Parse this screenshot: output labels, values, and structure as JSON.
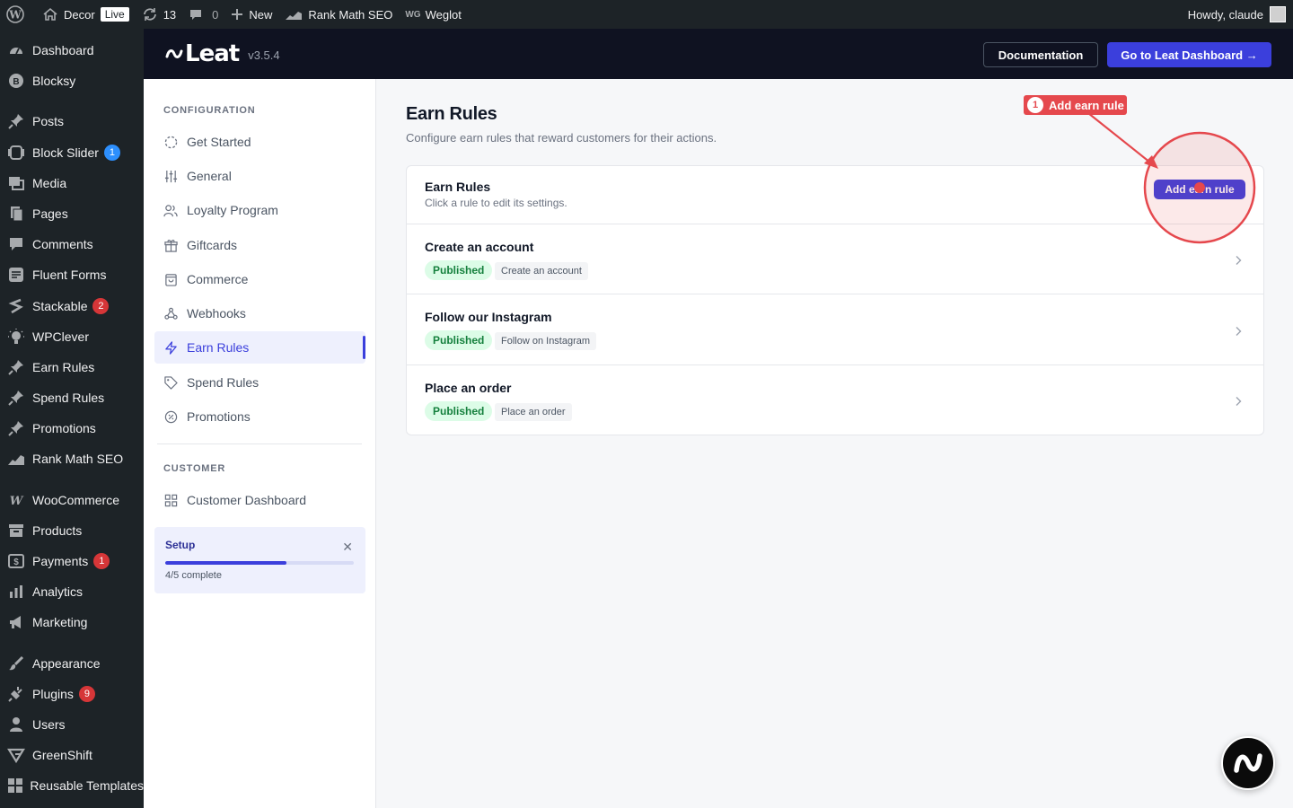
{
  "adminbar": {
    "site_name": "Decor",
    "live_label": "Live",
    "updates_count": "13",
    "comments_count": "0",
    "new_label": "New",
    "rankmath_label": "Rank Math SEO",
    "weglot_label": "Weglot",
    "greeting": "Howdy, claude"
  },
  "wp_menu": {
    "items": [
      {
        "label": "Dashboard",
        "icon": "dashboard-icon"
      },
      {
        "label": "Blocksy",
        "icon": "blocksy-icon"
      },
      {
        "label": "Posts",
        "icon": "pin-icon"
      },
      {
        "label": "Block Slider",
        "icon": "slider-icon",
        "badge": "1"
      },
      {
        "label": "Media",
        "icon": "media-icon"
      },
      {
        "label": "Pages",
        "icon": "pages-icon"
      },
      {
        "label": "Comments",
        "icon": "comment-icon"
      },
      {
        "label": "Fluent Forms",
        "icon": "forms-icon"
      },
      {
        "label": "Stackable",
        "icon": "stackable-icon",
        "badge": "2"
      },
      {
        "label": "WPClever",
        "icon": "lightbulb-icon"
      },
      {
        "label": "Earn Rules",
        "icon": "pin-icon"
      },
      {
        "label": "Spend Rules",
        "icon": "pin-icon"
      },
      {
        "label": "Promotions",
        "icon": "pin-icon"
      },
      {
        "label": "Rank Math SEO",
        "icon": "rankmath-icon"
      },
      {
        "label": "WooCommerce",
        "icon": "woo-icon"
      },
      {
        "label": "Products",
        "icon": "archive-icon"
      },
      {
        "label": "Payments",
        "icon": "payments-icon",
        "badge": "1"
      },
      {
        "label": "Analytics",
        "icon": "bar-chart-icon"
      },
      {
        "label": "Marketing",
        "icon": "megaphone-icon"
      },
      {
        "label": "Appearance",
        "icon": "brush-icon"
      },
      {
        "label": "Plugins",
        "icon": "plug-icon",
        "badge": "9"
      },
      {
        "label": "Users",
        "icon": "user-icon"
      },
      {
        "label": "GreenShift",
        "icon": "greenshift-icon"
      },
      {
        "label": "Reusable Templates",
        "icon": "grid-icon"
      }
    ]
  },
  "leat_header": {
    "logo_text": "Leat",
    "version": "v3.5.4",
    "docs_label": "Documentation",
    "dashboard_label": "Go to Leat Dashboard →"
  },
  "plugin_nav": {
    "section_config": "CONFIGURATION",
    "section_customer": "CUSTOMER",
    "items": [
      {
        "label": "Get Started",
        "icon": "circle-dashed-icon"
      },
      {
        "label": "General",
        "icon": "sliders-icon"
      },
      {
        "label": "Loyalty Program",
        "icon": "users-icon"
      },
      {
        "label": "Giftcards",
        "icon": "gift-icon"
      },
      {
        "label": "Commerce",
        "icon": "shopping-bag-icon"
      },
      {
        "label": "Webhooks",
        "icon": "webhook-icon"
      },
      {
        "label": "Earn Rules",
        "icon": "zap-icon",
        "active": true
      },
      {
        "label": "Spend Rules",
        "icon": "tag-icon"
      },
      {
        "label": "Promotions",
        "icon": "percent-badge-icon"
      },
      {
        "label": "Customer Dashboard",
        "icon": "layout-grid-icon"
      }
    ],
    "setup": {
      "title": "Setup",
      "progress_text": "4/5 complete",
      "progress_fraction": 0.8
    }
  },
  "main": {
    "title": "Earn Rules",
    "subtitle": "Configure earn rules that reward customers for their actions.",
    "card": {
      "title": "Earn Rules",
      "description": "Click a rule to edit its settings.",
      "add_label": "Add earn rule"
    },
    "rules": [
      {
        "name": "Create an account",
        "status": "Published",
        "type": "Create an account"
      },
      {
        "name": "Follow our Instagram",
        "status": "Published",
        "type": "Follow on Instagram"
      },
      {
        "name": "Place an order",
        "status": "Published",
        "type": "Place an order"
      }
    ]
  },
  "annotation": {
    "number": "1",
    "label": "Add earn rule",
    "color": "#e5484d"
  },
  "colors": {
    "accent": "#3b3fdc",
    "wp_dark": "#1d2327",
    "published_bg": "#dcfce7",
    "published_text": "#15803d"
  }
}
